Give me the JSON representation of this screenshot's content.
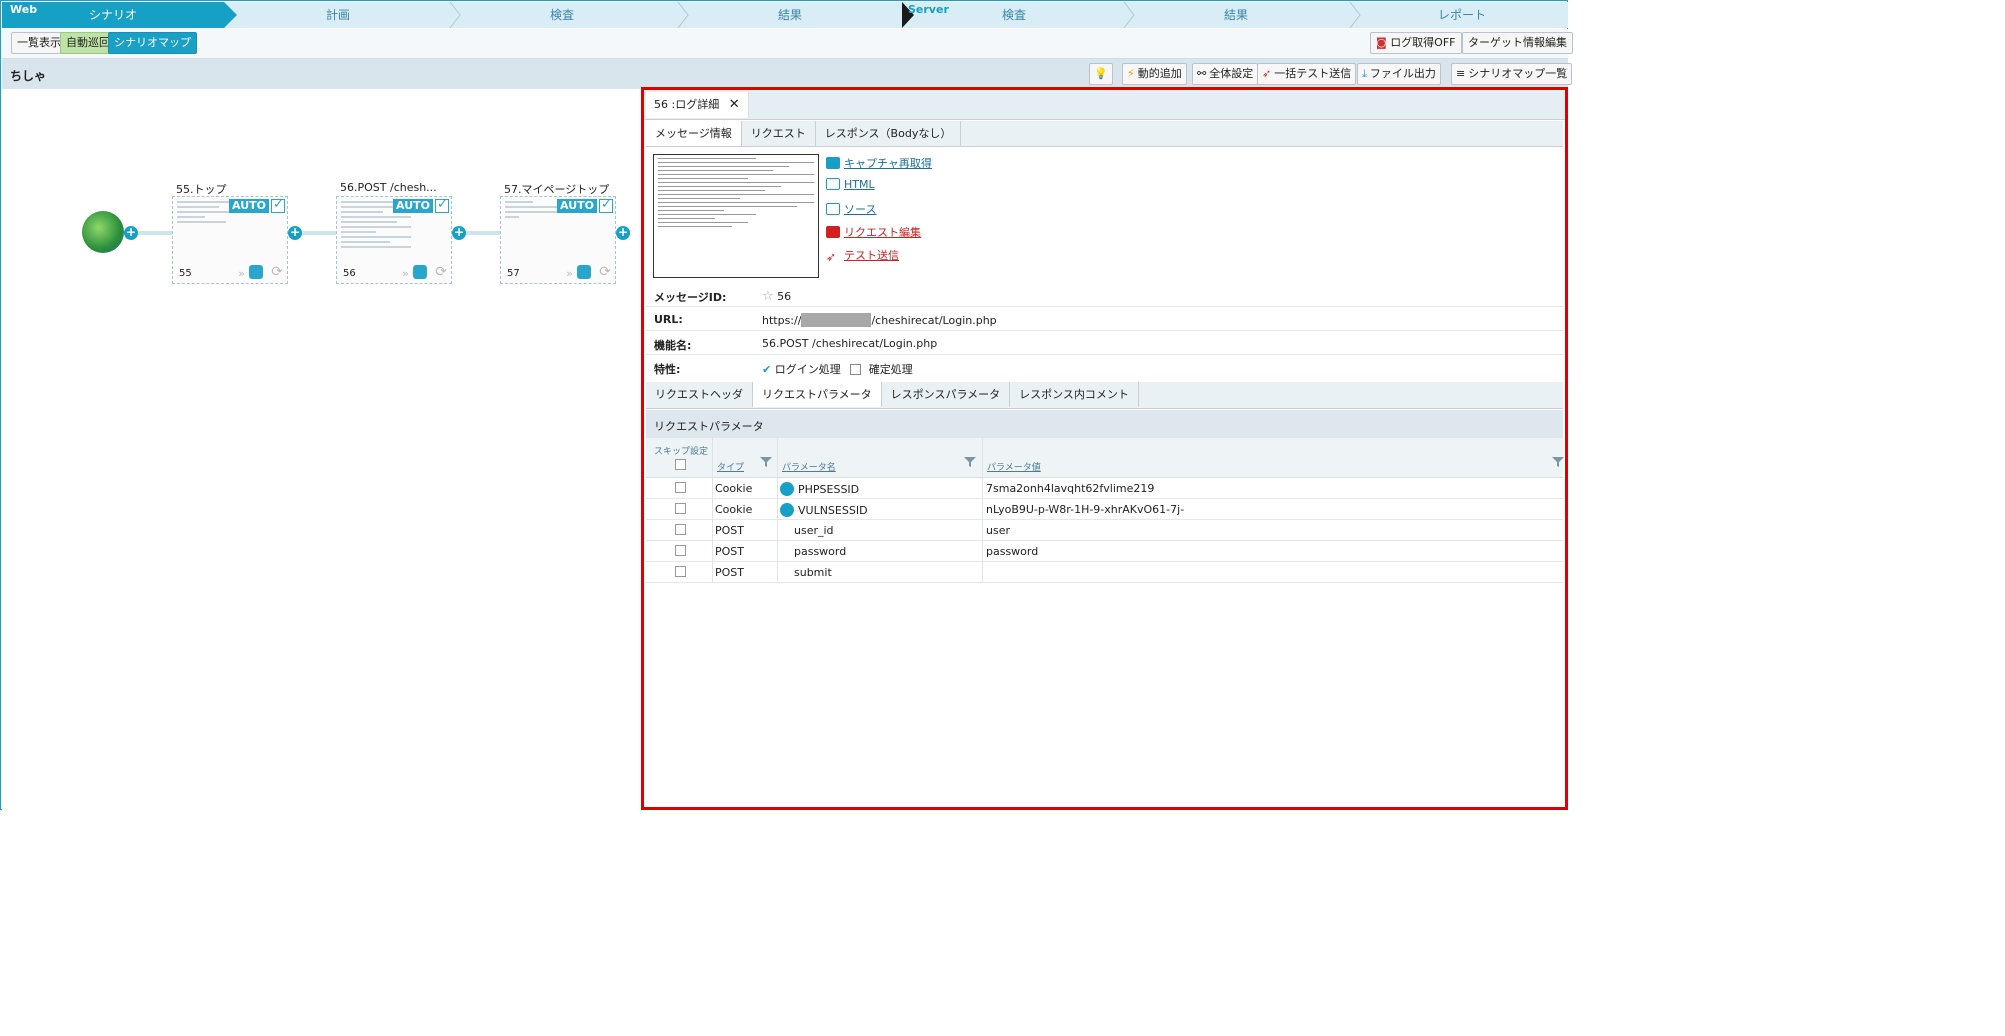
{
  "steps": {
    "web_tag": "Web",
    "server_tag": "Server",
    "items": [
      "シナリオ",
      "計画",
      "検査",
      "結果",
      "検査",
      "結果",
      "レポート"
    ]
  },
  "toolbar": {
    "view_list": "一覧表示",
    "auto_crawl": "自動巡回",
    "scenario_map": "シナリオマップ",
    "log_off": "ログ取得OFF",
    "target_edit": "ターゲット情報編集"
  },
  "scenario": {
    "title": "ちしゃ",
    "dynamic_add": "動的追加",
    "global_settings": "全体設定",
    "batch_test": "一括テスト送信",
    "file_output": "ファイル出力",
    "map_list": "シナリオマップ一覧"
  },
  "nodes": [
    {
      "label": "55.トップ",
      "badge": "AUTO",
      "num": "55"
    },
    {
      "label": "56.POST /chesh...",
      "badge": "AUTO",
      "num": "56"
    },
    {
      "label": "57.マイページトップ",
      "badge": "AUTO",
      "num": "57"
    }
  ],
  "panel": {
    "tab_title": "56 :ログ詳細",
    "close": "✕",
    "subtabs": [
      "メッセージ情報",
      "リクエスト",
      "レスポンス（Bodyなし）"
    ],
    "links": {
      "recapture": "キャプチャ再取得",
      "html": "HTML",
      "source": "ソース",
      "edit_request": "リクエスト編集",
      "test_send": "テスト送信"
    },
    "fields": {
      "message_id_label": "メッセージID:",
      "message_id": "56",
      "url_label": "URL:",
      "url_prefix": "https://",
      "url_suffix": "/cheshirecat/Login.php",
      "func_label": "機能名:",
      "func_name": "56.POST /cheshirecat/Login.php",
      "attr_label": "特性:",
      "login": "ログイン処理",
      "confirm": "確定処理"
    },
    "param_tabs": [
      "リクエストヘッダ",
      "リクエストパラメータ",
      "レスポンスパラメータ",
      "レスポンス内コメント"
    ],
    "section_title": "リクエストパラメータ",
    "columns": {
      "skip": "スキップ設定",
      "type": "タイプ",
      "name": "パラメータ名",
      "value": "パラメータ値"
    },
    "rows": [
      {
        "type": "Cookie",
        "name": "PHPSESSID",
        "value": "7sma2onh4lavqht62fvlime219",
        "key": true
      },
      {
        "type": "Cookie",
        "name": "VULNSESSID",
        "value": "nLyoB9U-p-W8r-1H-9-xhrAKvO61-7j-",
        "key": true
      },
      {
        "type": "POST",
        "name": "user_id",
        "value": "user",
        "key": false
      },
      {
        "type": "POST",
        "name": "password",
        "value": "password",
        "key": false
      },
      {
        "type": "POST",
        "name": "submit",
        "value": "",
        "key": false
      }
    ]
  },
  "colors": {
    "accent": "#16a0c6",
    "highlight": "#e00000"
  }
}
